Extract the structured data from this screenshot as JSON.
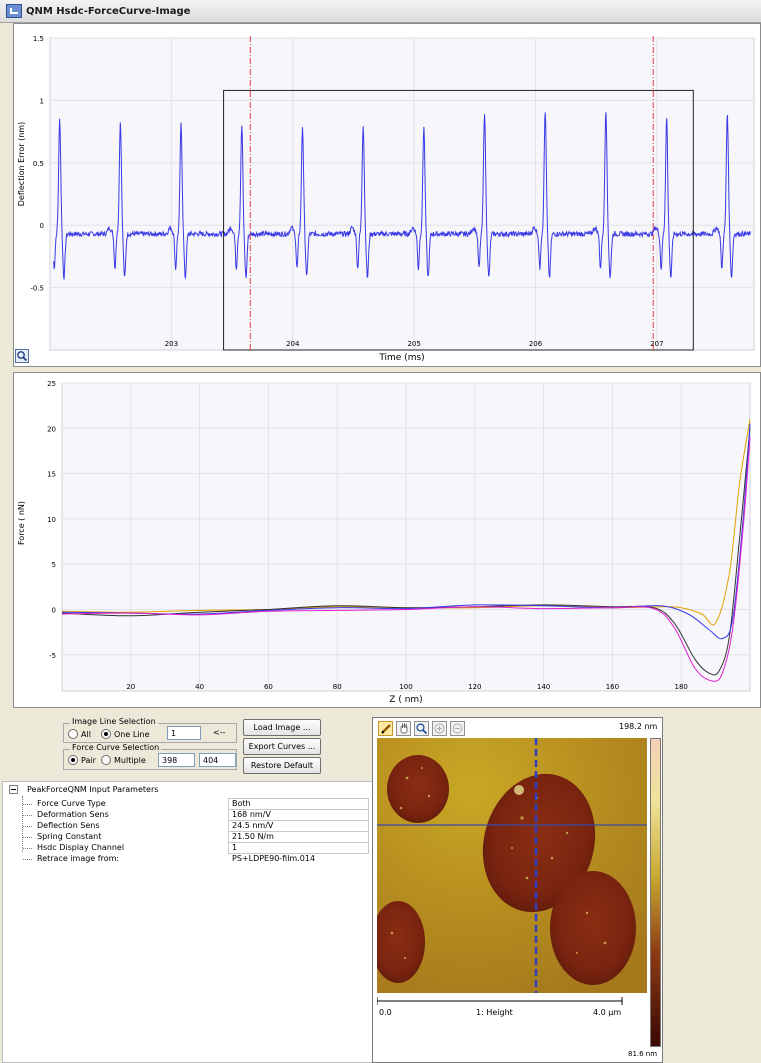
{
  "window": {
    "title": "QNM Hsdc-ForceCurve-Image"
  },
  "colors": {
    "trace": "#3a3ae6",
    "cursor": "#e04040",
    "approach": "#e0a000",
    "retrace_black": "#333333",
    "retrace_blue": "#3a3ae6",
    "retrace_magenta": "#e020d0"
  },
  "deflection_plot": {
    "chart_data": {
      "type": "line",
      "ylabel": "Deflection Error (nm)",
      "xlabel": "Time (ms)",
      "xlim": [
        202.0,
        207.8
      ],
      "ylim": [
        -1.0,
        1.5
      ],
      "x_ticks": [
        "203",
        "204",
        "205",
        "206",
        "207"
      ],
      "y_ticks": [
        "1.5",
        "1",
        "0.5",
        "0",
        "-0.5"
      ],
      "peak_times": [
        202.08,
        202.58,
        203.08,
        203.58,
        204.08,
        204.58,
        205.08,
        205.58,
        206.08,
        206.58,
        207.08,
        207.58
      ],
      "peak_values": [
        0.92,
        0.9,
        0.88,
        0.87,
        0.86,
        0.88,
        0.86,
        0.98,
        0.99,
        1.0,
        0.93,
        0.97
      ],
      "baseline": -0.07,
      "selection_box_x": [
        203.43,
        207.3
      ],
      "selection_box_y": [
        -1.0,
        1.08
      ],
      "cursor_lines_x": [
        203.65,
        206.97
      ]
    },
    "tick_labels": {
      "x": [
        "203",
        "204",
        "205",
        "206",
        "207"
      ],
      "y": [
        "1.5",
        "1",
        "0.5",
        "0",
        "-0.5"
      ]
    },
    "xlabel": "Time (ms)",
    "ylabel": "Deflection Error (nm)"
  },
  "force_plot": {
    "chart_data": {
      "type": "line",
      "ylabel": "Force ( nN)",
      "xlabel": "Z ( nm)",
      "xlim": [
        0,
        200
      ],
      "ylim": [
        -9,
        25
      ],
      "x_ticks": [
        "20",
        "40",
        "60",
        "80",
        "100",
        "120",
        "140",
        "160",
        "180"
      ],
      "y_ticks": [
        "25",
        "20",
        "15",
        "10",
        "5",
        "0",
        "-5"
      ],
      "series": [
        {
          "color": "#e0a000",
          "points": [
            [
              0,
              -0.2
            ],
            [
              20,
              -0.3
            ],
            [
              40,
              -0.1
            ],
            [
              60,
              0
            ],
            [
              80,
              0.3
            ],
            [
              100,
              0.2
            ],
            [
              120,
              0.2
            ],
            [
              140,
              0.4
            ],
            [
              160,
              0.2
            ],
            [
              175,
              0.3
            ],
            [
              180,
              0.2
            ],
            [
              186,
              -0.5
            ],
            [
              190,
              -1.5
            ],
            [
              194,
              4
            ],
            [
              197,
              14
            ],
            [
              200,
              21
            ]
          ]
        },
        {
          "color": "#333333",
          "points": [
            [
              0,
              -0.4
            ],
            [
              20,
              -0.7
            ],
            [
              40,
              -0.3
            ],
            [
              60,
              0
            ],
            [
              80,
              0.4
            ],
            [
              100,
              0.2
            ],
            [
              120,
              0.3
            ],
            [
              140,
              0.5
            ],
            [
              160,
              0.3
            ],
            [
              172,
              0.2
            ],
            [
              178,
              -1.5
            ],
            [
              184,
              -5.5
            ],
            [
              188,
              -7
            ],
            [
              191,
              -6.8
            ],
            [
              194,
              -3
            ],
            [
              197,
              8
            ],
            [
              200,
              20
            ]
          ]
        },
        {
          "color": "#3a3ae6",
          "points": [
            [
              0,
              -0.3
            ],
            [
              20,
              -0.4
            ],
            [
              40,
              -0.5
            ],
            [
              60,
              -0.1
            ],
            [
              80,
              0.2
            ],
            [
              100,
              0.1
            ],
            [
              120,
              0.5
            ],
            [
              140,
              0.4
            ],
            [
              160,
              0.2
            ],
            [
              174,
              0.4
            ],
            [
              182,
              -0.5
            ],
            [
              188,
              -2.2
            ],
            [
              192,
              -3.2
            ],
            [
              195,
              -1
            ],
            [
              198,
              10
            ],
            [
              200,
              20.5
            ]
          ]
        },
        {
          "color": "#e020d0",
          "points": [
            [
              0,
              -0.5
            ],
            [
              20,
              -0.4
            ],
            [
              40,
              -0.6
            ],
            [
              60,
              -0.2
            ],
            [
              80,
              -0.1
            ],
            [
              100,
              0
            ],
            [
              120,
              0.3
            ],
            [
              140,
              0.1
            ],
            [
              160,
              0.2
            ],
            [
              172,
              0.1
            ],
            [
              178,
              -2
            ],
            [
              184,
              -6.5
            ],
            [
              189,
              -7.9
            ],
            [
              192,
              -7
            ],
            [
              195,
              -2
            ],
            [
              198,
              9
            ],
            [
              200,
              19
            ]
          ]
        }
      ]
    },
    "tick_labels": {
      "x": [
        "20",
        "40",
        "60",
        "80",
        "100",
        "120",
        "140",
        "160",
        "180"
      ],
      "y": [
        "25",
        "20",
        "15",
        "10",
        "5",
        "0",
        "-5"
      ]
    },
    "xlabel": "Z ( nm)",
    "ylabel": "Force ( nN)"
  },
  "image_line_selection": {
    "label": "Image Line Selection",
    "all_label": "All",
    "one_line_label": "One Line",
    "selected": "One Line",
    "line_value": "1",
    "arrow_label": "<--"
  },
  "force_curve_selection": {
    "label": "Force Curve Selection",
    "pair_label": "Pair",
    "multiple_label": "Multiple",
    "selected": "Pair",
    "from_value": "398",
    "to_value": "404"
  },
  "buttons": {
    "load_image": "Load Image ...",
    "export_curves": "Export Curves ...",
    "restore_default": "Restore Default"
  },
  "params": {
    "title": "PeakForceQNM Input Parameters",
    "rows": [
      {
        "name": "Force Curve Type",
        "value": "Both"
      },
      {
        "name": "Deformation Sens",
        "value": "168 nm/V"
      },
      {
        "name": "Deflection Sens",
        "value": "24.5 nm/V"
      },
      {
        "name": "Spring Constant",
        "value": "21.50 N/m"
      },
      {
        "name": "Hsdc Display Channel",
        "value": "1"
      },
      {
        "name": "Retrace image from:",
        "value": "PS+LDPE90-film.014"
      }
    ]
  },
  "afm_image": {
    "scale_top": "198.2 nm",
    "scale_bottom": "81.6 nm",
    "axis_start": "0.0",
    "channel_label": "1: Height",
    "axis_end": "4.0 µm",
    "toolbar_icons": [
      "pencil-icon",
      "hand-icon",
      "magnifier-icon",
      "zoom-in-icon",
      "zoom-out-icon"
    ]
  }
}
